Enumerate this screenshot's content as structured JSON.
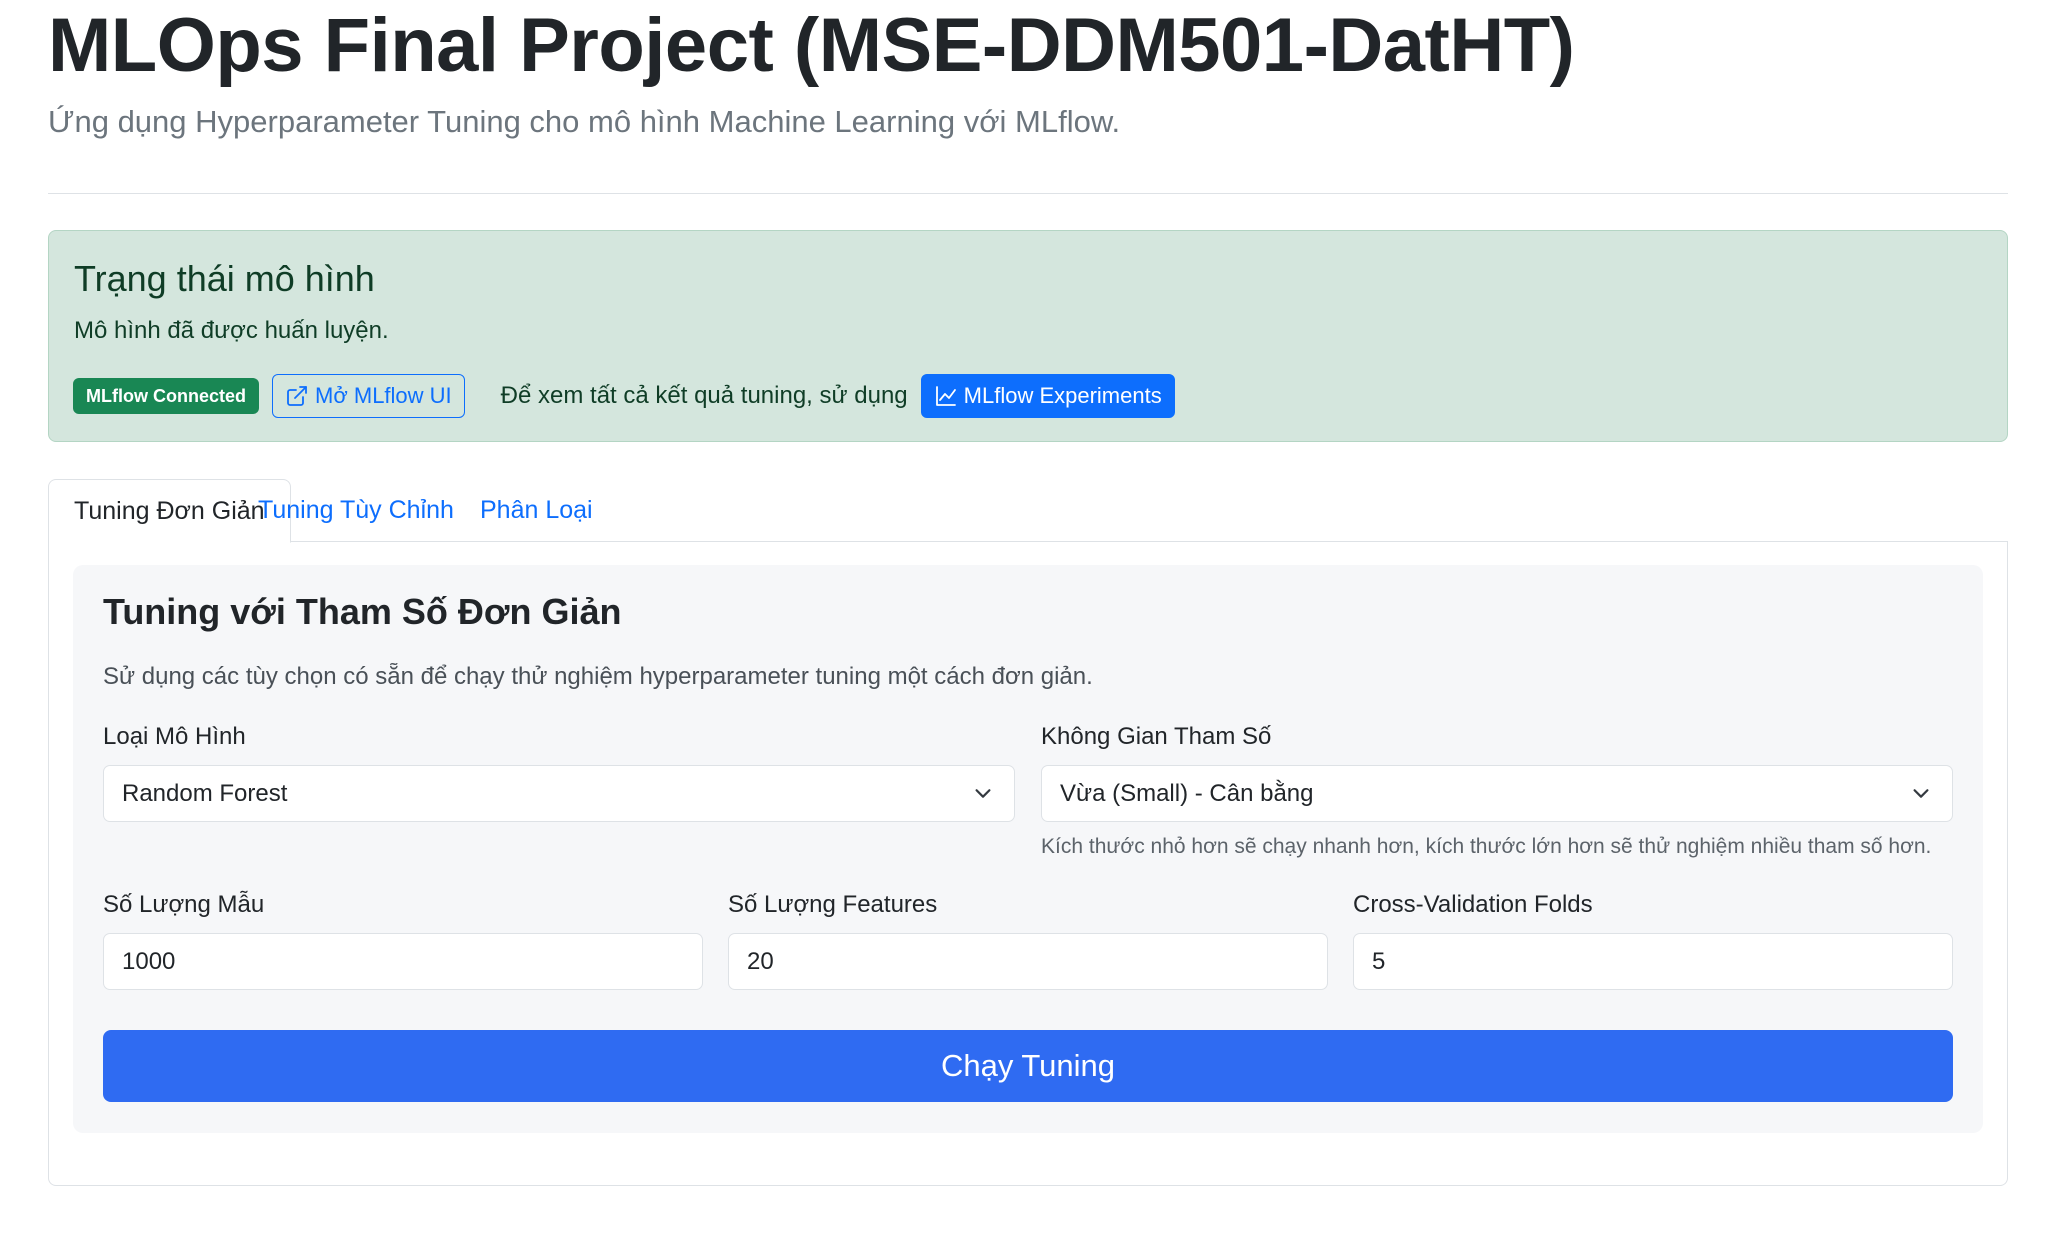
{
  "header": {
    "title": "MLOps Final Project (MSE-DDM501-DatHT)",
    "subtitle": "Ứng dụng Hyperparameter Tuning cho mô hình Machine Learning với MLflow."
  },
  "status": {
    "heading": "Trạng thái mô hình",
    "text": "Mô hình đã được huấn luyện.",
    "badge": "MLflow Connected",
    "open_ui_label": "Mở MLflow UI",
    "note": "Để xem tất cả kết quả tuning, sử dụng",
    "experiments_label": "MLflow Experiments"
  },
  "tabs": [
    {
      "label": "Tuning Đơn Giản",
      "active": true
    },
    {
      "label": "Tuning Tùy Chỉnh",
      "active": false
    },
    {
      "label": "Phân Loại",
      "active": false
    }
  ],
  "panel": {
    "title": "Tuning với Tham Số Đơn Giản",
    "description": "Sử dụng các tùy chọn có sẵn để chạy thử nghiệm hyperparameter tuning một cách đơn giản.",
    "model_type": {
      "label": "Loại Mô Hình",
      "value": "Random Forest"
    },
    "param_space": {
      "label": "Không Gian Tham Số",
      "value": "Vừa (Small) - Cân bằng",
      "help": "Kích thước nhỏ hơn sẽ chạy nhanh hơn, kích thước lớn hơn sẽ thử nghiệm nhiều tham số hơn."
    },
    "n_samples": {
      "label": "Số Lượng Mẫu",
      "value": "1000"
    },
    "n_features": {
      "label": "Số Lượng Features",
      "value": "20"
    },
    "cv_folds": {
      "label": "Cross-Validation Folds",
      "value": "5"
    },
    "run_label": "Chạy Tuning"
  },
  "colors": {
    "primary": "#0d6efd",
    "success": "#198754",
    "alert_bg": "#d4e6dd"
  }
}
